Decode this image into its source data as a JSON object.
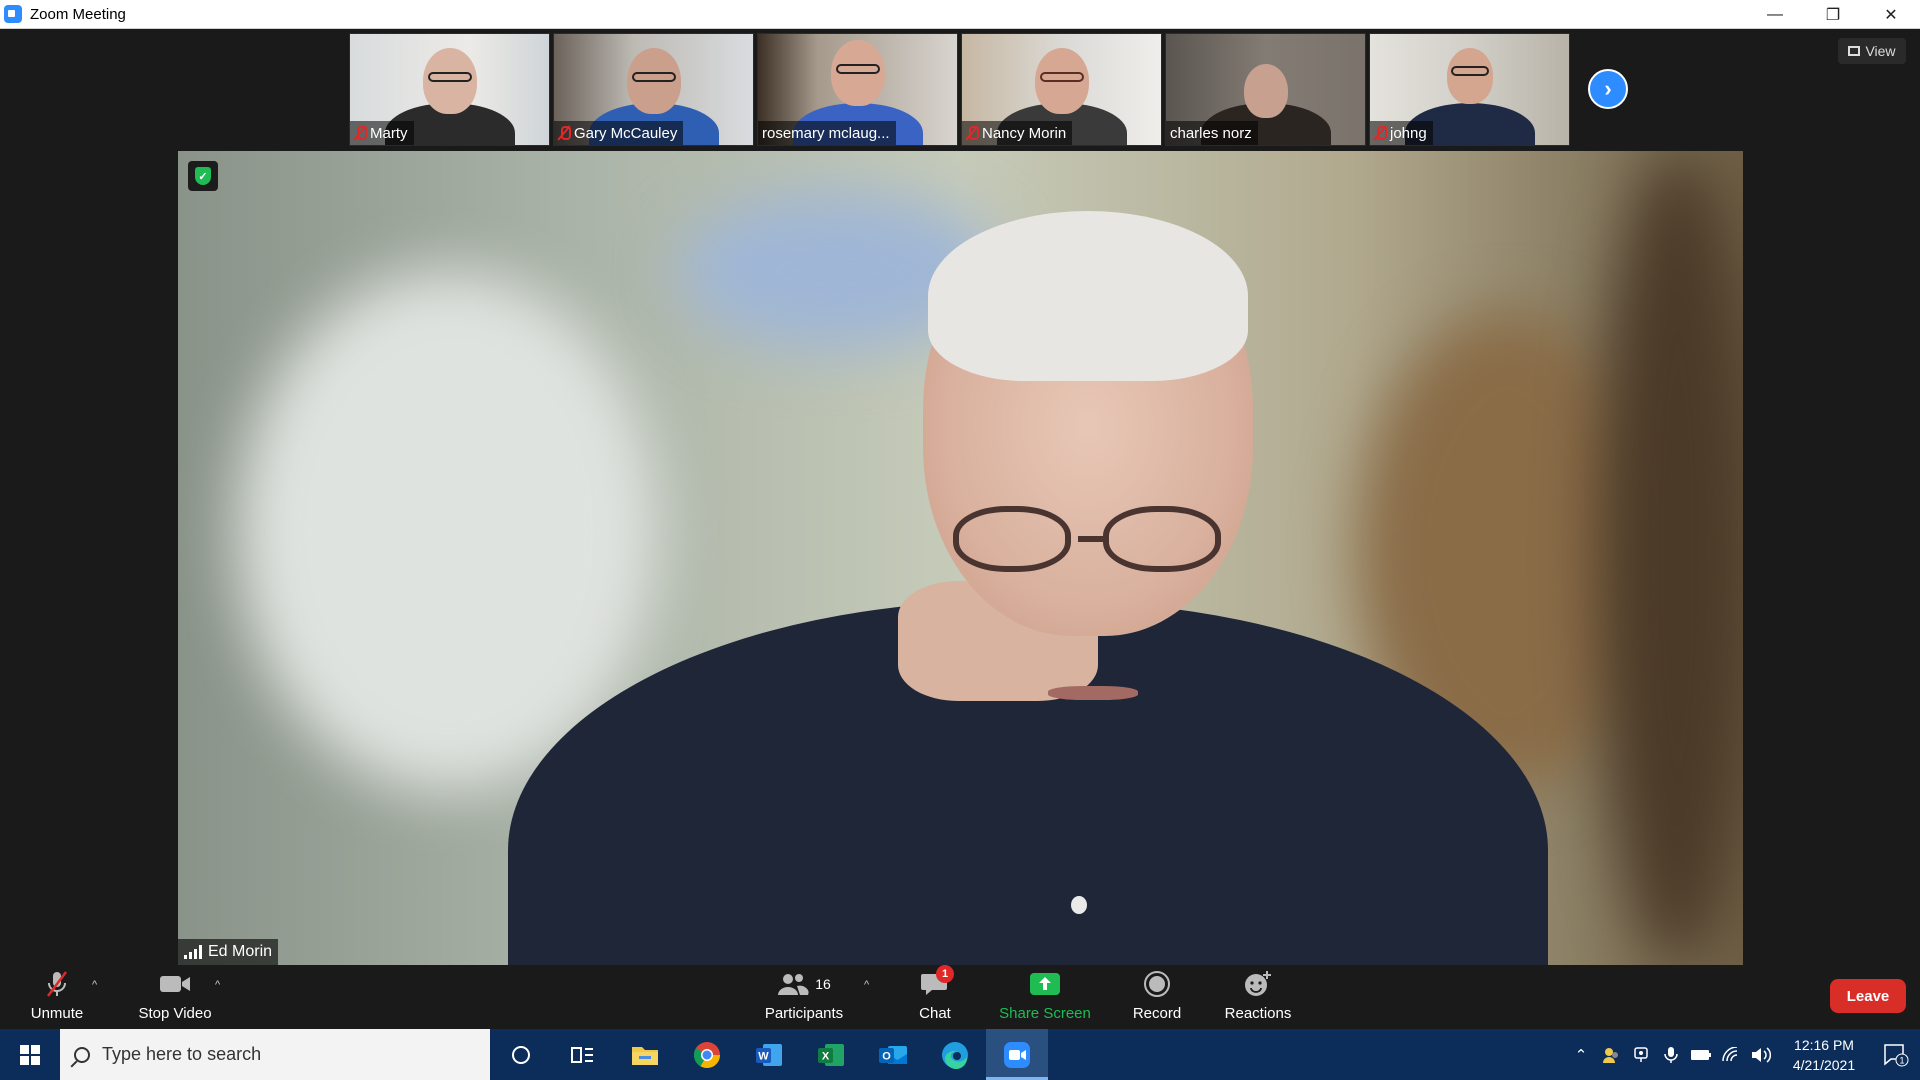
{
  "window": {
    "title": "Zoom Meeting",
    "controls": {
      "minimize": "—",
      "restore": "❐",
      "close": "✕"
    }
  },
  "gallery": {
    "participants": [
      {
        "name": "Marty",
        "muted": true
      },
      {
        "name": "Gary McCauley",
        "muted": true
      },
      {
        "name": "rosemary mclaug...",
        "muted": false
      },
      {
        "name": "Nancy Morin",
        "muted": true
      },
      {
        "name": "charles norz",
        "muted": false
      },
      {
        "name": "johng",
        "muted": true
      }
    ],
    "next_icon": "›",
    "view_label": "View"
  },
  "speaker": {
    "name": "Ed Morin",
    "security_icon": "shield-check-icon"
  },
  "toolbar": {
    "unmute_label": "Unmute",
    "stop_video_label": "Stop Video",
    "participants_label": "Participants",
    "participants_count": "16",
    "chat_label": "Chat",
    "chat_badge": "1",
    "share_screen_label": "Share Screen",
    "record_label": "Record",
    "reactions_label": "Reactions",
    "leave_label": "Leave",
    "caret": "^"
  },
  "taskbar": {
    "search_placeholder": "Type here to search",
    "time": "12:16 PM",
    "date": "4/21/2021",
    "notification_count": "1"
  },
  "colors": {
    "zoom_blue": "#2d8cff",
    "share_green": "#1ebc53",
    "leave_red": "#d92d27",
    "taskbar": "#0c2d5a"
  }
}
